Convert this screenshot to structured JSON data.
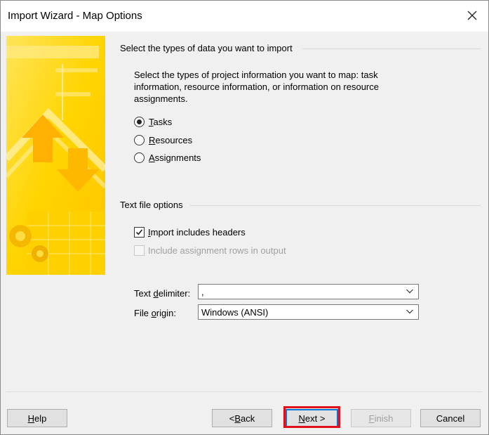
{
  "window": {
    "title": "Import Wizard - Map Options",
    "close_icon": "close-icon"
  },
  "section_types": {
    "title": "Select the types of data you want to import",
    "description": "Select the types of project information you want to map: task information, resource information, or information on resource assignments.",
    "options": [
      {
        "label_accel": "T",
        "label_rest": "asks",
        "selected": true
      },
      {
        "label_accel": "R",
        "label_rest": "esources",
        "selected": false
      },
      {
        "label_accel": "A",
        "label_rest": "ssignments",
        "selected": false
      }
    ]
  },
  "section_text": {
    "title": "Text file options",
    "import_headers": {
      "label_accel": "I",
      "label_rest": "mport includes headers",
      "checked": true,
      "enabled": true
    },
    "include_assignment_rows": {
      "label_accel": "",
      "label_rest": "Include assignment rows in output",
      "checked": false,
      "enabled": false
    },
    "delimiter": {
      "label_pre": "Text ",
      "label_accel": "d",
      "label_post": "elimiter:",
      "value": ","
    },
    "file_origin": {
      "label_pre": "File ",
      "label_accel": "o",
      "label_post": "rigin:",
      "value": "Windows (ANSI)"
    }
  },
  "buttons": {
    "help": {
      "accel": "H",
      "rest": "elp"
    },
    "back": {
      "pre": "< ",
      "accel": "B",
      "rest": "ack"
    },
    "next": {
      "accel": "N",
      "rest": "ext >"
    },
    "finish": {
      "accel": "F",
      "rest": "inish"
    },
    "cancel": "Cancel"
  },
  "colors": {
    "art_yellow": "#ffd800",
    "highlight_red": "#e0101a",
    "focus_blue": "#0078d7"
  }
}
